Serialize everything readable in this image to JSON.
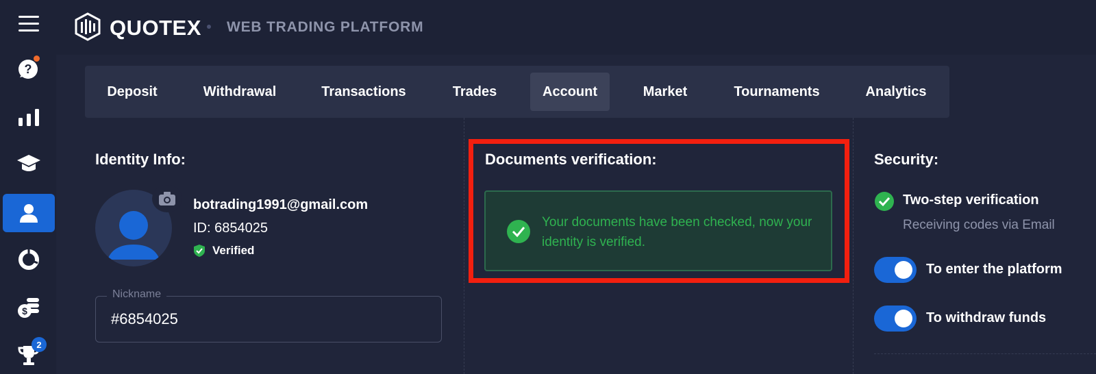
{
  "app": {
    "brand": "QUOTEX",
    "tagline": "WEB TRADING PLATFORM"
  },
  "sidebar": {
    "items": [
      {
        "name": "menu",
        "icon": "hamburger-menu-icon"
      },
      {
        "name": "support",
        "icon": "help-chat-icon"
      },
      {
        "name": "trading",
        "icon": "bar-chart-icon"
      },
      {
        "name": "education",
        "icon": "graduation-cap-icon"
      },
      {
        "name": "account",
        "icon": "user-icon",
        "active": true
      },
      {
        "name": "market",
        "icon": "donut-chart-icon"
      },
      {
        "name": "funds",
        "icon": "coins-icon"
      },
      {
        "name": "tournaments",
        "icon": "trophy-icon",
        "badge": "2"
      }
    ]
  },
  "tabs": [
    {
      "label": "Deposit"
    },
    {
      "label": "Withdrawal"
    },
    {
      "label": "Transactions"
    },
    {
      "label": "Trades"
    },
    {
      "label": "Account",
      "active": true
    },
    {
      "label": "Market"
    },
    {
      "label": "Tournaments"
    },
    {
      "label": "Analytics"
    }
  ],
  "identity": {
    "title": "Identity Info:",
    "email": "botrading1991@gmail.com",
    "id_label": "ID: 6854025",
    "verified_label": "Verified",
    "nickname_label": "Nickname",
    "nickname_value": "#6854025"
  },
  "documents": {
    "title": "Documents verification:",
    "message": "Your documents have been checked, now your identity is verified."
  },
  "security": {
    "title": "Security:",
    "two_step_label": "Two-step verification",
    "two_step_sub": "Receiving codes via Email",
    "toggles": [
      {
        "label": "To enter the platform",
        "on": true
      },
      {
        "label": "To withdraw funds",
        "on": true
      }
    ]
  },
  "colors": {
    "background": "#20253a",
    "accent": "#1a67d6",
    "success": "#2fb350",
    "highlight": "#f21f0f"
  }
}
